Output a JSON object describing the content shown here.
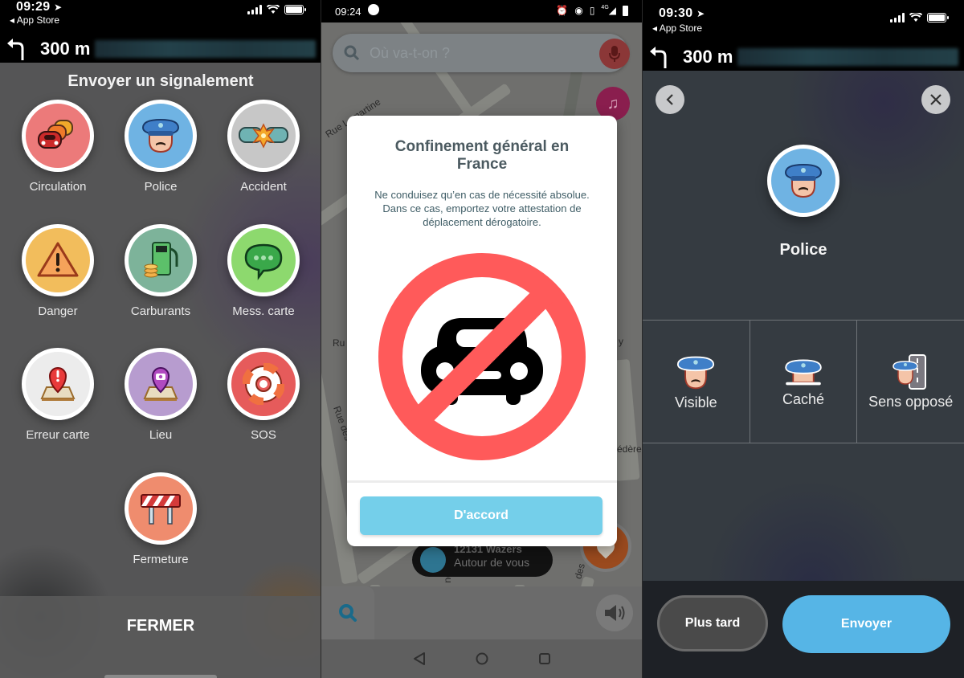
{
  "panel_report_menu": {
    "status_bar": {
      "time": "09:29",
      "back_label": "App Store"
    },
    "navigation": {
      "distance": "300 m"
    },
    "title": "Envoyer un signalement",
    "items": [
      {
        "label": "Circulation",
        "icon": "traffic-jam-icon",
        "color": "#ec7a7a"
      },
      {
        "label": "Police",
        "icon": "police-icon",
        "color": "#6fb3e3"
      },
      {
        "label": "Accident",
        "icon": "accident-icon",
        "color": "#c7c7c7"
      },
      {
        "label": "Danger",
        "icon": "hazard-icon",
        "color": "#f2bd5c"
      },
      {
        "label": "Carburants",
        "icon": "fuel-pump-icon",
        "color": "#7db39a"
      },
      {
        "label": "Mess. carte",
        "icon": "chat-bubble-icon",
        "color": "#8dd96e"
      },
      {
        "label": "Erreur carte",
        "icon": "map-error-icon",
        "color": "#ececec"
      },
      {
        "label": "Lieu",
        "icon": "place-camera-icon",
        "color": "#b79ccf"
      },
      {
        "label": "SOS",
        "icon": "lifebuoy-icon",
        "color": "#e65b5b"
      },
      {
        "label": "Fermeture",
        "icon": "road-closure-icon",
        "color": "#ef8c6e"
      }
    ],
    "close_label": "FERMER"
  },
  "panel_dialog": {
    "status_bar": {
      "time": "09:24",
      "network": "4G"
    },
    "search_placeholder": "Où va-t-on ?",
    "map_labels": [
      "Rue Lamartine",
      "Ru",
      "Rue des",
      "y",
      "édère",
      "des",
      "ou"
    ],
    "wazers": {
      "count": "12131 Wazers",
      "subtitle": "Autour de vous"
    },
    "dialog": {
      "title": "Confinement général en France",
      "body": "Ne conduisez qu’en cas de nécessité absolue. Dans ce cas, emportez votre attestation de déplacement dérogatoire.",
      "image": "no-cars-sign",
      "ok_label": "D'accord"
    },
    "colors": {
      "accent": "#74cfea",
      "sign_red": "#ff5a5a"
    }
  },
  "panel_police": {
    "status_bar": {
      "time": "09:30",
      "back_label": "App Store"
    },
    "navigation": {
      "distance": "300 m"
    },
    "title": "Police",
    "options": [
      {
        "label": "Visible",
        "icon": "police-visible-icon"
      },
      {
        "label": "Caché",
        "icon": "police-hidden-icon"
      },
      {
        "label": "Sens opposé",
        "icon": "police-opposite-icon"
      }
    ],
    "later_label": "Plus tard",
    "send_label": "Envoyer",
    "colors": {
      "send": "#56b5e6"
    }
  }
}
